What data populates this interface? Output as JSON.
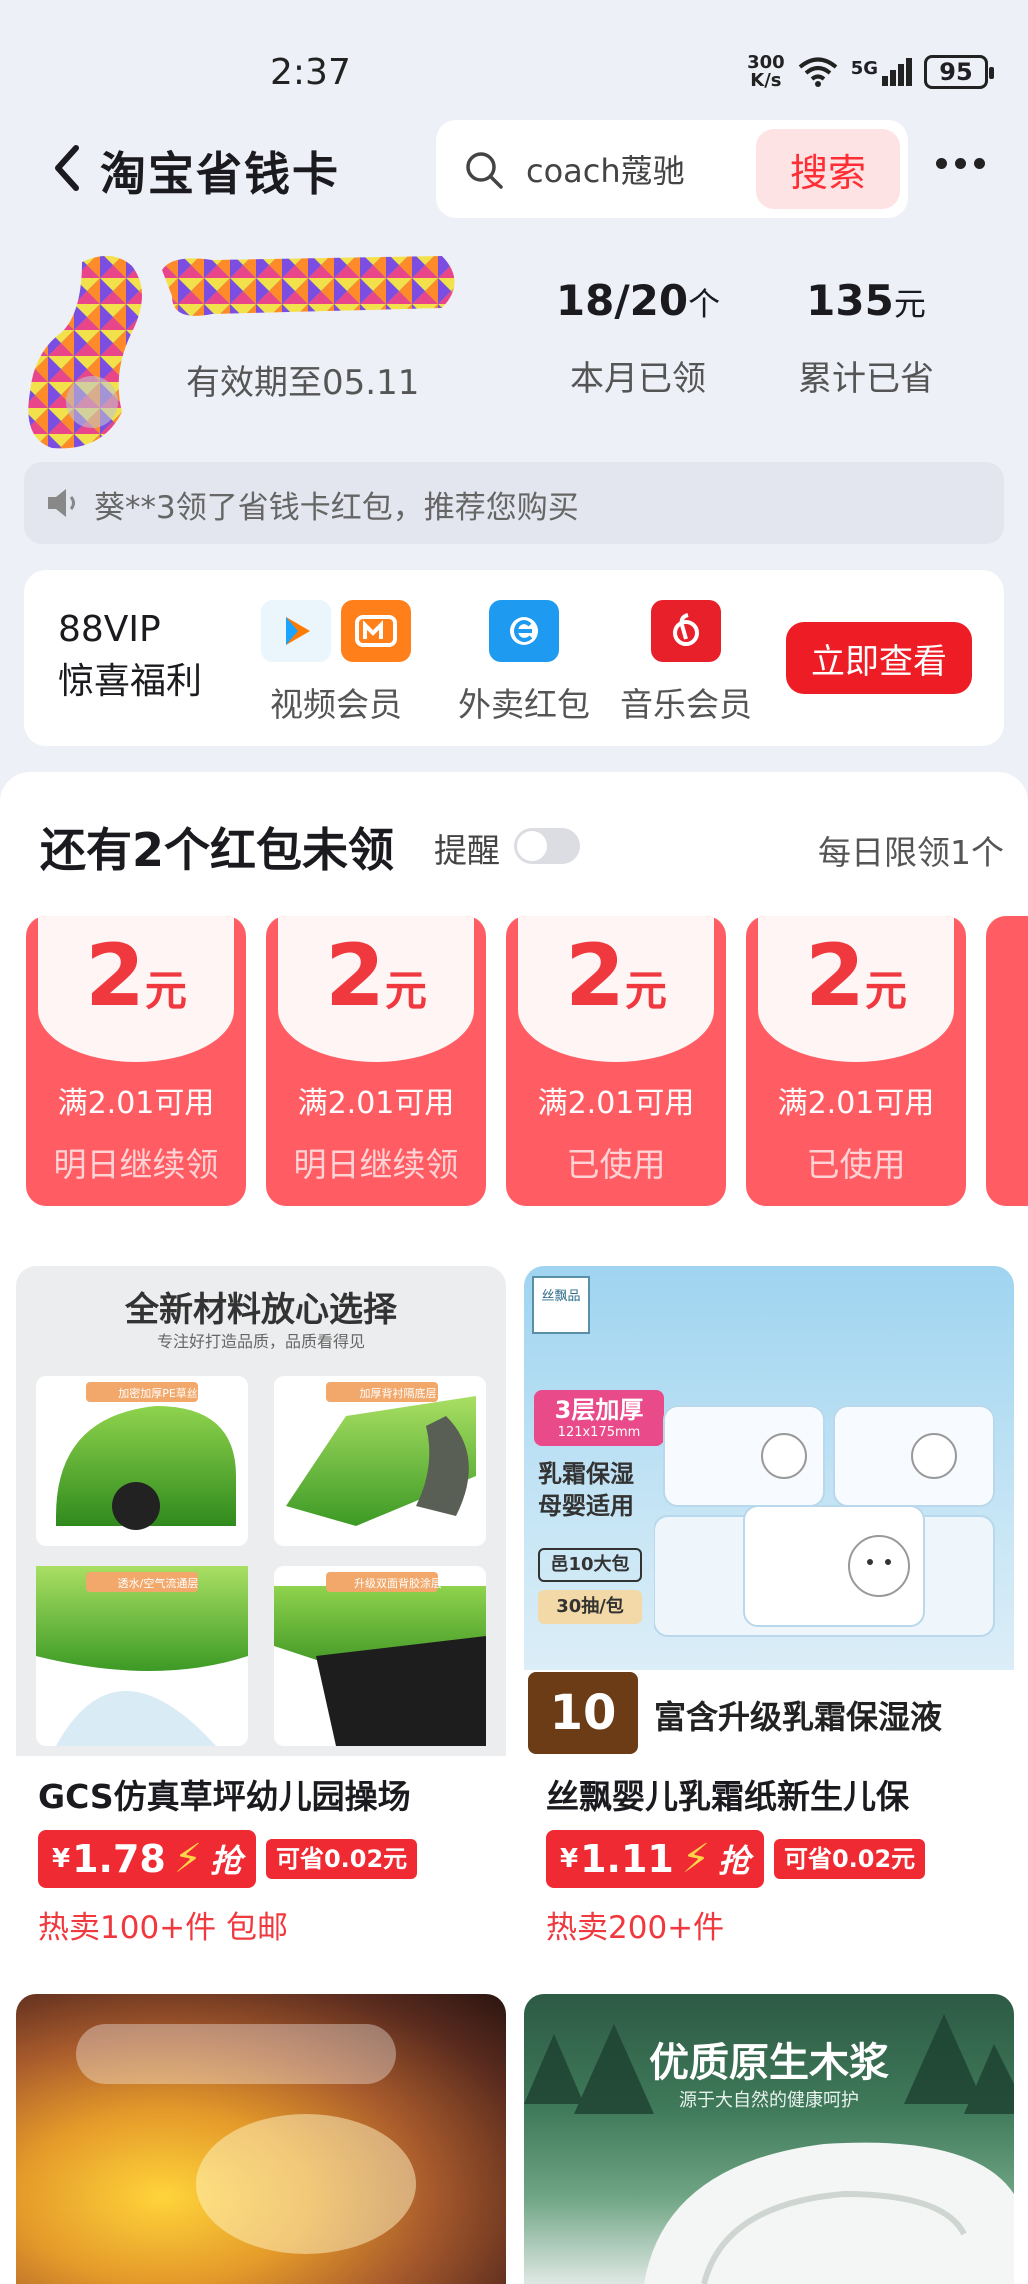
{
  "status_bar": {
    "time": "2:37",
    "net_speed_value": "300",
    "net_speed_unit": "K/s",
    "signal_label": "5G",
    "battery": "95"
  },
  "header": {
    "title": "淘宝省钱卡",
    "search_text": "coach蔻驰",
    "search_button": "搜索"
  },
  "profile": {
    "valid_until": "有效期至05.11",
    "stats": [
      {
        "value": "18/20",
        "unit": "个",
        "label": "本月已领"
      },
      {
        "value": "135",
        "unit": "元",
        "label": "累计已省"
      }
    ]
  },
  "notice": {
    "text": "葵**3领了省钱卡红包，推荐您购买"
  },
  "vip": {
    "title_line1": "88VIP",
    "title_line2": "惊喜福利",
    "items": [
      {
        "label": "视频会员",
        "icons": [
          "tencent-video-icon",
          "mango-tv-icon"
        ]
      },
      {
        "label": "外卖红包",
        "icons": [
          "eleme-icon"
        ]
      },
      {
        "label": "音乐会员",
        "icons": [
          "netease-music-icon"
        ]
      }
    ],
    "cta": "立即查看"
  },
  "red_packets": {
    "title": "还有2个红包未领",
    "remind_label": "提醒",
    "remind_enabled": false,
    "daily_limit": "每日限领1个",
    "coupons": [
      {
        "amount": "2",
        "unit": "元",
        "condition": "满2.01可用",
        "state": "明日继续领"
      },
      {
        "amount": "2",
        "unit": "元",
        "condition": "满2.01可用",
        "state": "明日继续领"
      },
      {
        "amount": "2",
        "unit": "元",
        "condition": "满2.01可用",
        "state": "已使用"
      },
      {
        "amount": "2",
        "unit": "元",
        "condition": "满2.01可用",
        "state": "已使用"
      }
    ]
  },
  "products": [
    {
      "img_heading": "全新材料放心选择",
      "img_subheading": "专注好打造品质，品质看得见",
      "img_tags": [
        "加密加厚PE草丝",
        "加厚背衬隔底层",
        "透水/空气流通层",
        "升级双面背胶涂层"
      ],
      "title": "GCS仿真草坪幼儿园操场",
      "currency": "¥",
      "price": "1.78",
      "grab": "抢",
      "save": "可省0.02元",
      "sold": "热卖100+件 包邮"
    },
    {
      "img_brand": "丝飘品",
      "img_badge_line1": "3层加厚",
      "img_badge_line2": "121x175mm",
      "img_feature": "乳霜保湿 母婴适用",
      "img_pack": "邑10大包",
      "img_count": "30抽/包",
      "img_big_number": "10包",
      "img_bottom_text": "富含升级乳霜保湿液",
      "title": "丝飘婴儿乳霜纸新生儿保",
      "currency": "¥",
      "price": "1.11",
      "grab": "抢",
      "save": "可省0.02元",
      "sold": "热卖200+件"
    },
    {
      "title": ""
    },
    {
      "img_heading": "优质原生木浆",
      "img_subheading": "源于大自然的健康呵护"
    }
  ],
  "colors": {
    "accent_red": "#f02a32",
    "coupon_red": "#ff5d63",
    "page_bg": "#eef0f7"
  }
}
